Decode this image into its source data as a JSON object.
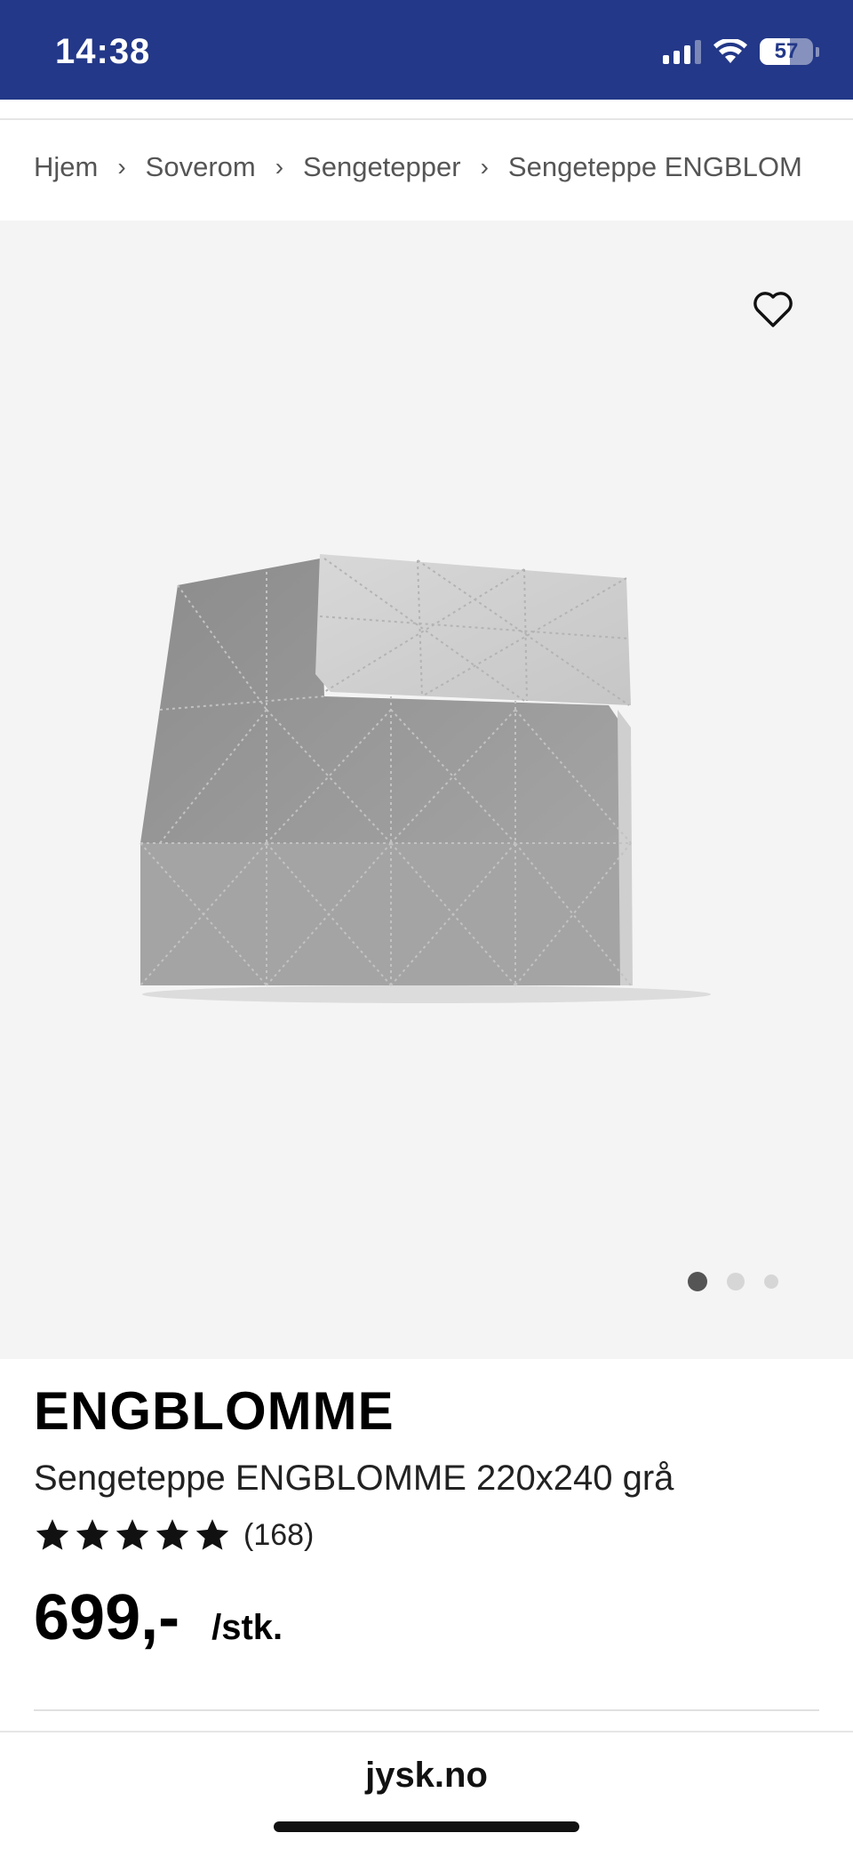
{
  "status_bar": {
    "time": "14:38",
    "battery_level": "57",
    "battery_fraction": 0.57,
    "background_color": "#233888"
  },
  "breadcrumb": {
    "items": [
      "Hjem",
      "Soverom",
      "Sengetepper",
      "Sengeteppe ENGBLOM"
    ],
    "separator_icon": "chevron-right-icon"
  },
  "gallery": {
    "favorite_icon": "heart-outline-icon",
    "image_count": 3,
    "active_index": 0
  },
  "product": {
    "brand": "ENGBLOMME",
    "name": "Sengeteppe ENGBLOMME 220x240 grå",
    "rating_stars": 5,
    "rating_count": "(168)",
    "price": "699,-",
    "unit": "/stk."
  },
  "browser": {
    "url": "jysk.no"
  }
}
